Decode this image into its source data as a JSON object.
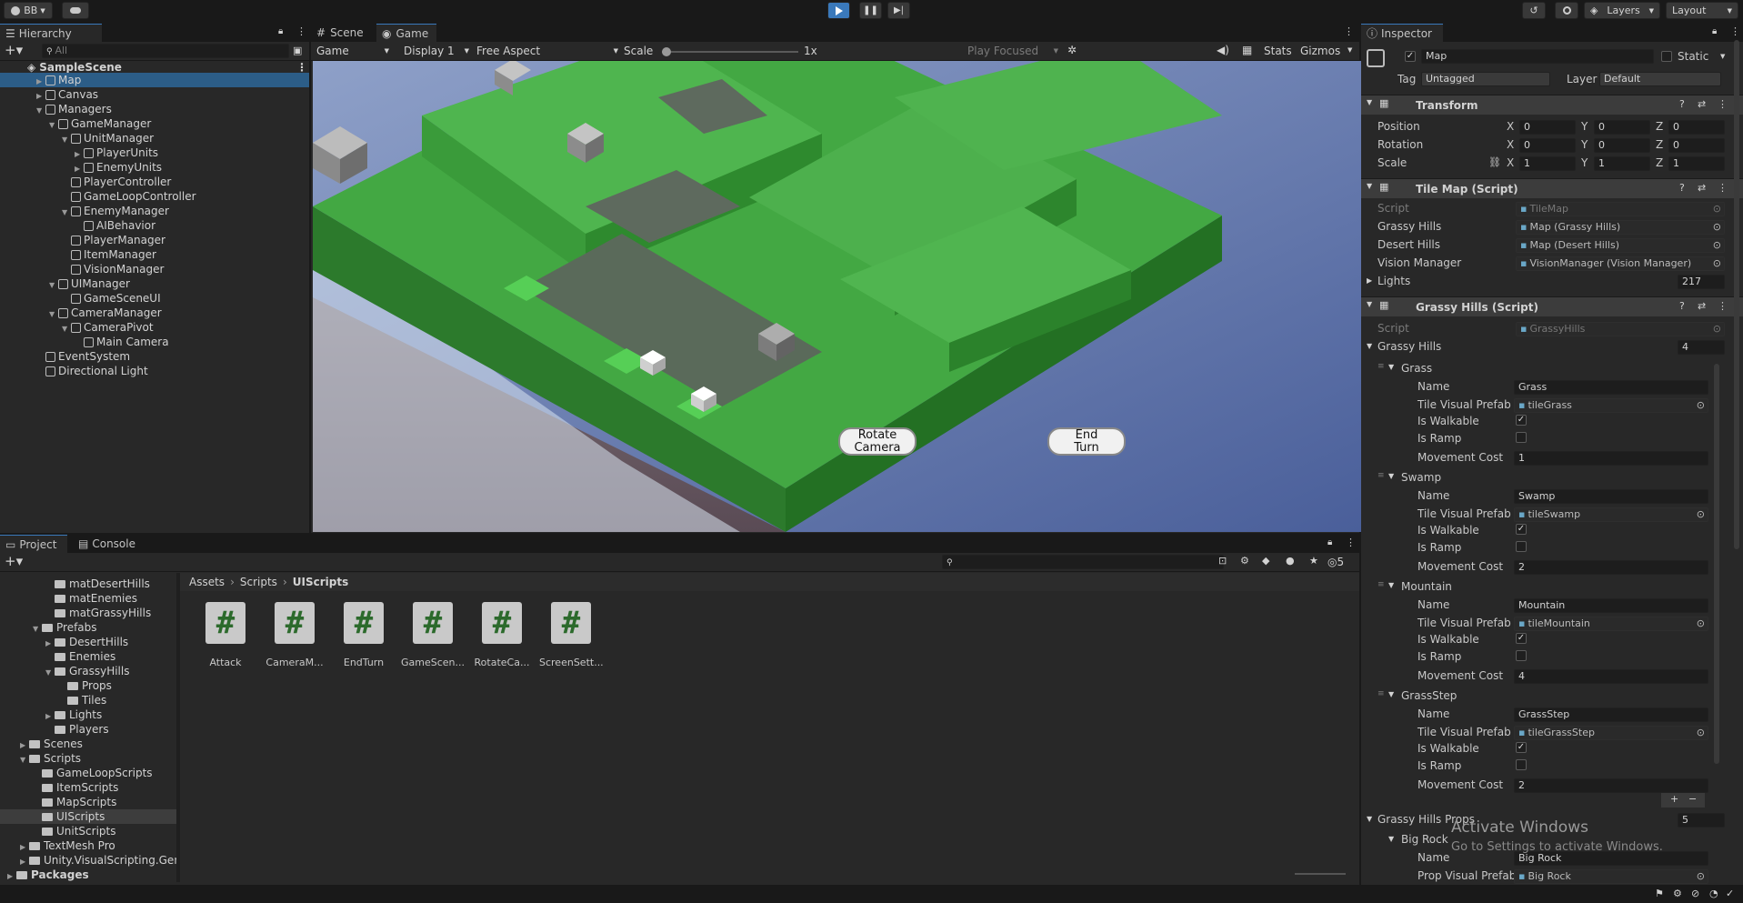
{
  "toolbar": {
    "account": "BB",
    "layers": "Layers",
    "layout": "Layout"
  },
  "hierarchy": {
    "tab": "Hierarchy",
    "search_placeholder": "All",
    "scene": "SampleScene",
    "items": [
      "Map",
      "Canvas",
      "Managers",
      "GameManager",
      "UnitManager",
      "PlayerUnits",
      "EnemyUnits",
      "PlayerController",
      "GameLoopController",
      "EnemyManager",
      "AIBehavior",
      "PlayerManager",
      "ItemManager",
      "VisionManager",
      "UIManager",
      "GameSceneUI",
      "CameraManager",
      "CameraPivot",
      "Main Camera",
      "EventSystem",
      "Directional Light"
    ]
  },
  "game_view": {
    "tab_scene": "Scene",
    "tab_game": "Game",
    "mode": "Game",
    "display": "Display 1",
    "aspect": "Free Aspect",
    "scale_label": "Scale",
    "scale_value": "1x",
    "play_focused": "Play Focused",
    "stats": "Stats",
    "gizmos": "Gizmos",
    "btn_rotate": "Rotate Camera",
    "btn_end": "End Turn"
  },
  "project": {
    "tab_project": "Project",
    "tab_console": "Console",
    "breadcrumb": [
      "Assets",
      "Scripts",
      "UIScripts"
    ],
    "badge": "5",
    "tree": [
      "matDesertHills",
      "matEnemies",
      "matGrassyHills",
      "Prefabs",
      "DesertHills",
      "Enemies",
      "GrassyHills",
      "Props",
      "Tiles",
      "Lights",
      "Players",
      "Scenes",
      "Scripts",
      "GameLoopScripts",
      "ItemScripts",
      "MapScripts",
      "UIScripts",
      "UnitScripts",
      "TextMesh Pro",
      "Unity.VisualScripting.Gene",
      "Packages"
    ],
    "assets": [
      "Attack",
      "CameraM...",
      "EndTurn",
      "GameScen...",
      "RotateCa...",
      "ScreenSett..."
    ]
  },
  "inspector": {
    "tab": "Inspector",
    "object_name": "Map",
    "static": "Static",
    "tag_label": "Tag",
    "tag_value": "Untagged",
    "layer_label": "Layer",
    "layer_value": "Default",
    "transform": {
      "title": "Transform",
      "position": "Position",
      "rotation": "Rotation",
      "scale": "Scale",
      "x": "X",
      "y": "Y",
      "z": "Z",
      "pos": [
        "0",
        "0",
        "0"
      ],
      "rot": [
        "0",
        "0",
        "0"
      ],
      "scl": [
        "1",
        "1",
        "1"
      ]
    },
    "tilemap": {
      "title": "Tile Map (Script)",
      "script_label": "Script",
      "script_value": "TileMap",
      "grassy_label": "Grassy Hills",
      "grassy_value": "Map (Grassy Hills)",
      "desert_label": "Desert Hills",
      "desert_value": "Map (Desert Hills)",
      "vision_label": "Vision Manager",
      "vision_value": "VisionManager (Vision Manager)",
      "lights_label": "Lights",
      "lights_value": "217"
    },
    "grassy": {
      "title": "Grassy Hills (Script)",
      "script_label": "Script",
      "script_value": "GrassyHills",
      "list_label": "Grassy Hills",
      "list_count": "4",
      "name_label": "Name",
      "prefab_label": "Tile Visual Prefab",
      "walk_label": "Is Walkable",
      "ramp_label": "Is Ramp",
      "cost_label": "Movement Cost",
      "tiles": [
        {
          "header": "Grass",
          "name": "Grass",
          "prefab": "tileGrass",
          "cost": "1"
        },
        {
          "header": "Swamp",
          "name": "Swamp",
          "prefab": "tileSwamp",
          "cost": "2"
        },
        {
          "header": "Mountain",
          "name": "Mountain",
          "prefab": "tileMountain",
          "cost": "4"
        },
        {
          "header": "GrassStep",
          "name": "GrassStep",
          "prefab": "tileGrassStep",
          "cost": "2"
        }
      ],
      "props_label": "Grassy Hills Props",
      "props_count": "5",
      "prop_header": "Big Rock",
      "prop_name": "Big Rock",
      "prop_prefab_label": "Prop Visual Prefab",
      "prop_prefab": "Big Rock"
    },
    "watermark1": "Activate Windows",
    "watermark2": "Go to Settings to activate Windows."
  }
}
